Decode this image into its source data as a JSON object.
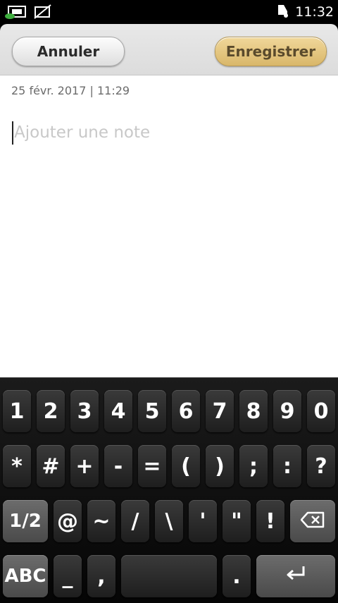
{
  "status_bar": {
    "time": "11:32",
    "icons": [
      "usb-charge-icon",
      "no-sim-icon",
      "bell-icon"
    ]
  },
  "header": {
    "cancel_label": "Annuler",
    "save_label": "Enregistrer"
  },
  "note": {
    "timestamp": "25 févr. 2017 | 11:29",
    "placeholder": "Ajouter une note"
  },
  "keyboard": {
    "row1": [
      "1",
      "2",
      "3",
      "4",
      "5",
      "6",
      "7",
      "8",
      "9",
      "0"
    ],
    "row2": [
      "*",
      "#",
      "+",
      "-",
      "=",
      "(",
      ")",
      ";",
      ":",
      "?"
    ],
    "row3": [
      "1/2",
      "@",
      "~",
      "/",
      "\\",
      "'",
      "\"",
      "!"
    ],
    "row4": [
      "ABC",
      "_",
      ",",
      "."
    ],
    "backspace_icon": "backspace-icon",
    "enter_icon": "enter-icon"
  },
  "colors": {
    "save_button": "#e0c078",
    "header_bg": "#e2e2e2",
    "keyboard_bg": "#111111"
  }
}
